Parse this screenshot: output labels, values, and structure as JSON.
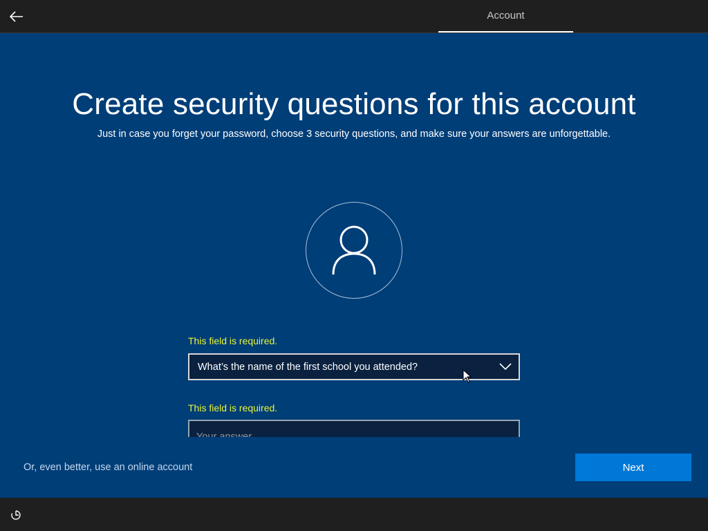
{
  "header": {
    "back_icon": "back-arrow-icon",
    "active_tab": "Account"
  },
  "main": {
    "title": "Create security questions for this account",
    "subtitle": "Just in case you forget your password, choose 3 security questions, and make sure your answers are unforgettable.",
    "avatar_icon": "user-icon",
    "question1": {
      "error": "This field is required.",
      "selected": "What’s the name of the first school you attended?"
    },
    "answer1": {
      "error": "This field is required.",
      "placeholder": "Your answer",
      "value": ""
    }
  },
  "footer": {
    "online_account_link": "Or, even better, use an online account",
    "next_label": "Next",
    "accessibility_icon": "ease-of-access-icon"
  },
  "colors": {
    "background": "#003e78",
    "accent": "#0078d7",
    "error": "#e8f535"
  }
}
